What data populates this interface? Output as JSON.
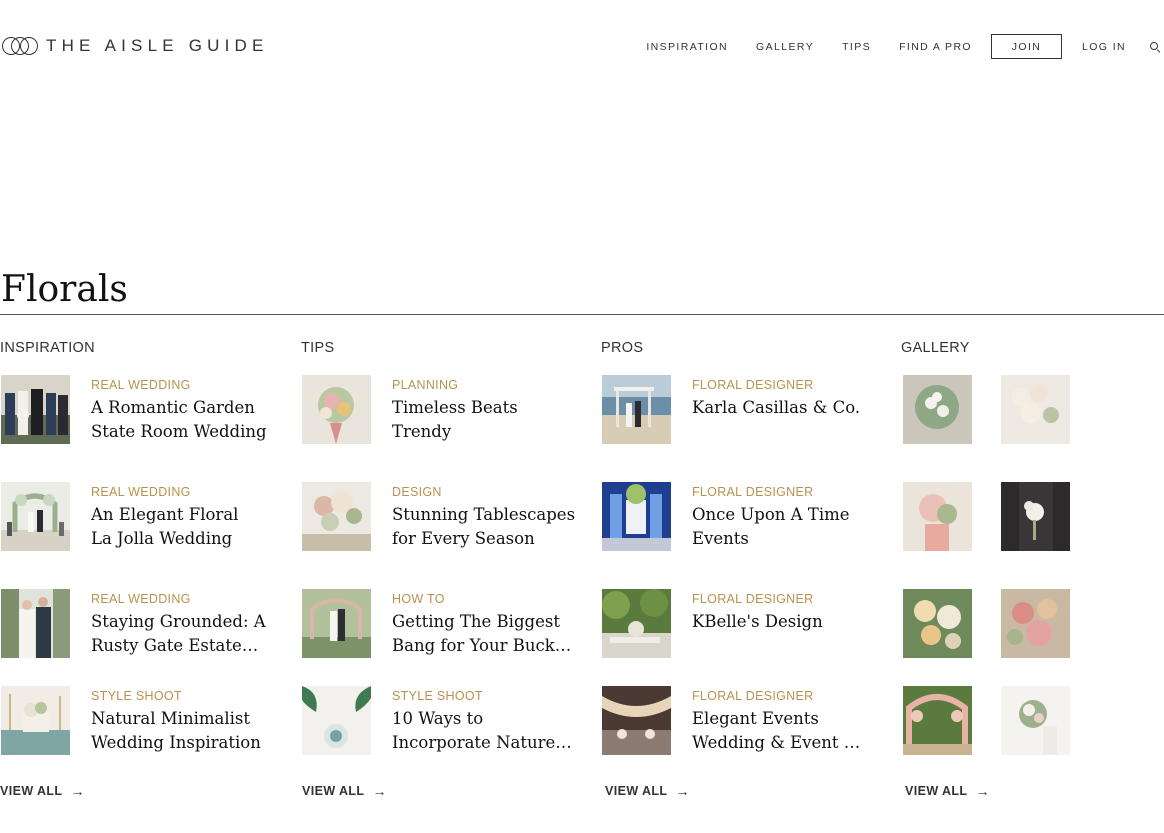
{
  "header": {
    "logo_text": "THE AISLE GUIDE",
    "nav": {
      "inspiration": "INSPIRATION",
      "gallery": "GALLERY",
      "tips": "TIPS",
      "find_a_pro": "FIND A PRO",
      "join": "JOIN",
      "log_in": "LOG IN"
    },
    "search_icon": "search-icon"
  },
  "page": {
    "title": "Florals"
  },
  "inspiration": {
    "heading": "INSPIRATION",
    "items": [
      {
        "category": "REAL WEDDING",
        "title_line1": "A Romantic Garden",
        "title_line2": "State Room Wedding"
      },
      {
        "category": "REAL WEDDING",
        "title_line1": "An Elegant Floral",
        "title_line2": "La Jolla Wedding"
      },
      {
        "category": "REAL WEDDING",
        "title_line1": "Staying Grounded: A",
        "title_line2": "Rusty Gate Estate…"
      },
      {
        "category": "STYLE SHOOT",
        "title_line1": "Natural Minimalist",
        "title_line2": "Wedding Inspiration"
      }
    ],
    "view_all": "VIEW ALL"
  },
  "tips": {
    "heading": "TIPS",
    "items": [
      {
        "category": "PLANNING",
        "title_line1": "Timeless Beats",
        "title_line2": "Trendy"
      },
      {
        "category": "DESIGN",
        "title_line1": "Stunning Tablescapes",
        "title_line2": "for Every Season"
      },
      {
        "category": "HOW TO",
        "title_line1": "Getting The Biggest",
        "title_line2": "Bang for Your Buck…"
      },
      {
        "category": "STYLE SHOOT",
        "title_line1": "10 Ways to",
        "title_line2": "Incorporate Nature…"
      }
    ],
    "view_all": "VIEW ALL"
  },
  "pros": {
    "heading": "PROS",
    "items": [
      {
        "category": "FLORAL DESIGNER",
        "title_line1": "Karla Casillas & Co.",
        "title_line2": ""
      },
      {
        "category": "FLORAL DESIGNER",
        "title_line1": "Once Upon A Time",
        "title_line2": "Events"
      },
      {
        "category": "FLORAL DESIGNER",
        "title_line1": "KBelle's Design",
        "title_line2": ""
      },
      {
        "category": "FLORAL DESIGNER",
        "title_line1": "Elegant Events",
        "title_line2": "Wedding & Event …"
      }
    ],
    "view_all": "VIEW ALL"
  },
  "gallery": {
    "heading": "GALLERY",
    "view_all": "VIEW ALL"
  },
  "colors": {
    "accent": "#b8924e",
    "text": "#222222",
    "rule": "#555555"
  }
}
